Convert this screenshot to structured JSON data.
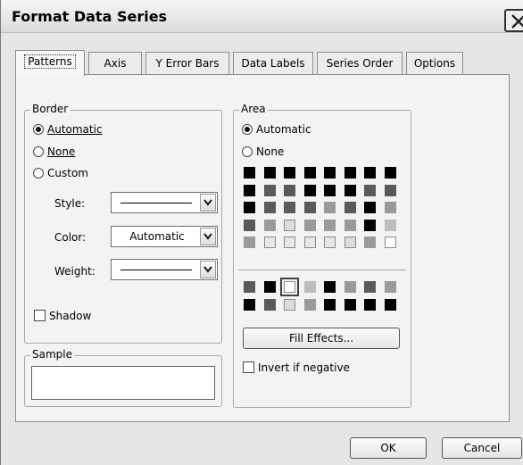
{
  "window": {
    "title": "Format Data Series"
  },
  "tabs": [
    {
      "label": "Patterns",
      "active": true
    },
    {
      "label": "Axis"
    },
    {
      "label": "Y Error Bars"
    },
    {
      "label": "Data Labels"
    },
    {
      "label": "Series Order"
    },
    {
      "label": "Options"
    }
  ],
  "border": {
    "legend": "Border",
    "automatic_label": "Automatic",
    "none_label": "None",
    "custom_label": "Custom",
    "selected": "Automatic",
    "style_label": "Style:",
    "color_label": "Color:",
    "color_value": "Automatic",
    "weight_label": "Weight:",
    "shadow_label": "Shadow",
    "shadow_checked": false
  },
  "sample": {
    "legend": "Sample"
  },
  "area": {
    "legend": "Area",
    "automatic_label": "Automatic",
    "none_label": "None",
    "selected": "Automatic",
    "fill_effects_label": "Fill Effects...",
    "invert_label": "Invert if negative",
    "invert_checked": false,
    "palette_top": [
      [
        "#000000",
        "#000000",
        "#000000",
        "#000000",
        "#000000",
        "#000000",
        "#000000",
        "#000000"
      ],
      [
        "#000000",
        "#5a5a5a",
        "#5a5a5a",
        "#000000",
        "#000000",
        "#000000",
        "#5a5a5a",
        "#5a5a5a"
      ],
      [
        "#000000",
        "#5a5a5a",
        "#5a5a5a",
        "#5a5a5a",
        "#9a9a9a",
        "#5a5a5a",
        "#000000",
        "#9a9a9a"
      ],
      [
        "#5a5a5a",
        "#9a9a9a",
        "#dcdcdc",
        "#9a9a9a",
        "#9a9a9a",
        "#9a9a9a",
        "#000000",
        "#bdbdbd"
      ],
      [
        "#9a9a9a",
        "#e8e8e8",
        "#e8e8e8",
        "#e8e8e8",
        "#e8e8e8",
        "#dcdcdc",
        "#9a9a9a",
        "#ffffff"
      ]
    ],
    "palette_bottom": [
      [
        "#5a5a5a",
        "#000000",
        "#ffffff",
        "#bdbdbd",
        "#000000",
        "#9a9a9a",
        "#5a5a5a",
        "#9a9a9a"
      ],
      [
        "#000000",
        "#5a5a5a",
        "#dcdcdc",
        "#9a9a9a",
        "#000000",
        "#000000",
        "#000000",
        "#000000"
      ]
    ]
  },
  "buttons": {
    "ok": "OK",
    "cancel": "Cancel"
  }
}
